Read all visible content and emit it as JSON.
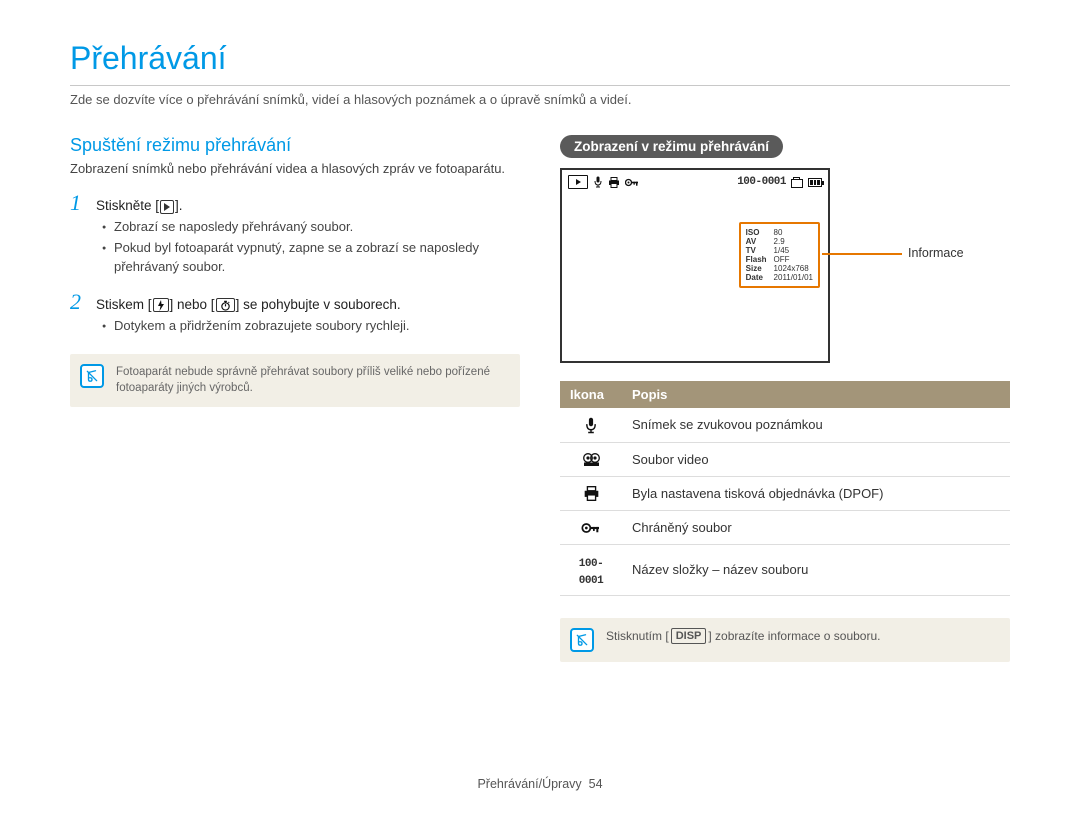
{
  "title": "Přehrávání",
  "intro": "Zde se dozvíte více o přehrávání snímků, videí a hlasových poznámek a o úpravě snímků a videí.",
  "left": {
    "section_title": "Spuštění režimu přehrávání",
    "section_sub": "Zobrazení snímků nebo přehrávání videa a hlasových zpráv ve fotoaparátu.",
    "step1": {
      "num": "1",
      "prefix": "Stiskněte [",
      "suffix": "]."
    },
    "step1_bullets": [
      "Zobrazí se naposledy přehrávaný soubor.",
      "Pokud byl fotoaparát vypnutý, zapne se a zobrazí se naposledy přehrávaný soubor."
    ],
    "step2": {
      "num": "2",
      "prefix": "Stiskem [",
      "mid1": "] nebo [",
      "suffix": "] se pohybujte v souborech."
    },
    "step2_bullets": [
      "Dotykem a přidržením zobrazujete soubory rychleji."
    ],
    "note": "Fotoaparát nebude správně přehrávat soubory příliš veliké nebo pořízené fotoaparáty jiných výrobců."
  },
  "right": {
    "pill": "Zobrazení v režimu přehrávání",
    "callout": "Informace",
    "lcd_file_label": "100-0001",
    "info": [
      {
        "k": "ISO",
        "v": "80"
      },
      {
        "k": "AV",
        "v": "2.9"
      },
      {
        "k": "TV",
        "v": "1/45"
      },
      {
        "k": "Flash",
        "v": "OFF"
      },
      {
        "k": "Size",
        "v": "1024x768"
      },
      {
        "k": "Date",
        "v": "2011/01/01"
      }
    ],
    "table": {
      "h1": "Ikona",
      "h2": "Popis",
      "rows": [
        {
          "icon": "mic",
          "desc": "Snímek se zvukovou poznámkou"
        },
        {
          "icon": "video",
          "desc": "Soubor video"
        },
        {
          "icon": "print",
          "desc": "Byla nastavena tisková objednávka (DPOF)"
        },
        {
          "icon": "key",
          "desc": "Chráněný soubor"
        },
        {
          "icon": "file",
          "desc": "Název složky – název souboru"
        }
      ]
    },
    "note_prefix": "Stisknutím [",
    "note_disp": "DISP",
    "note_suffix": "] zobrazíte informace o souboru."
  },
  "footer": {
    "label": "Přehrávání/Úpravy",
    "page": "54"
  }
}
